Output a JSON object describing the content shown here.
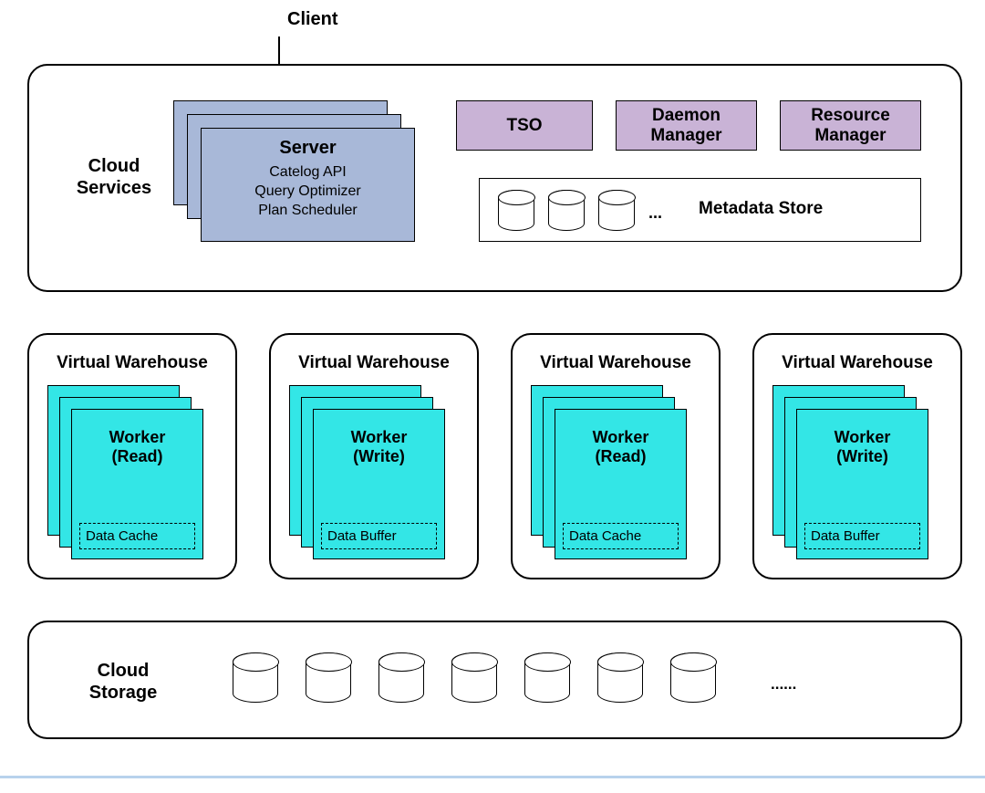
{
  "client_label": "Client",
  "cloud_services": {
    "label": "Cloud\nServices",
    "server": {
      "title": "Server",
      "lines": [
        "Catelog API",
        "Query Optimizer",
        "Plan Scheduler"
      ]
    },
    "purple_boxes": [
      {
        "label": "TSO"
      },
      {
        "label": "Daemon\nManager"
      },
      {
        "label": "Resource\nManager"
      }
    ],
    "metadata_store": {
      "label": "Metadata Store",
      "ellipsis": "..."
    }
  },
  "warehouses": [
    {
      "title": "Virtual Warehouse",
      "worker_title": "Worker\n(Read)",
      "inner_box": "Data Cache"
    },
    {
      "title": "Virtual Warehouse",
      "worker_title": "Worker\n(Write)",
      "inner_box": "Data Buffer"
    },
    {
      "title": "Virtual Warehouse",
      "worker_title": "Worker\n(Read)",
      "inner_box": "Data Cache"
    },
    {
      "title": "Virtual Warehouse",
      "worker_title": "Worker\n(Write)",
      "inner_box": "Data Buffer"
    }
  ],
  "cloud_storage": {
    "label": "Cloud\nStorage",
    "ellipsis": "......"
  }
}
